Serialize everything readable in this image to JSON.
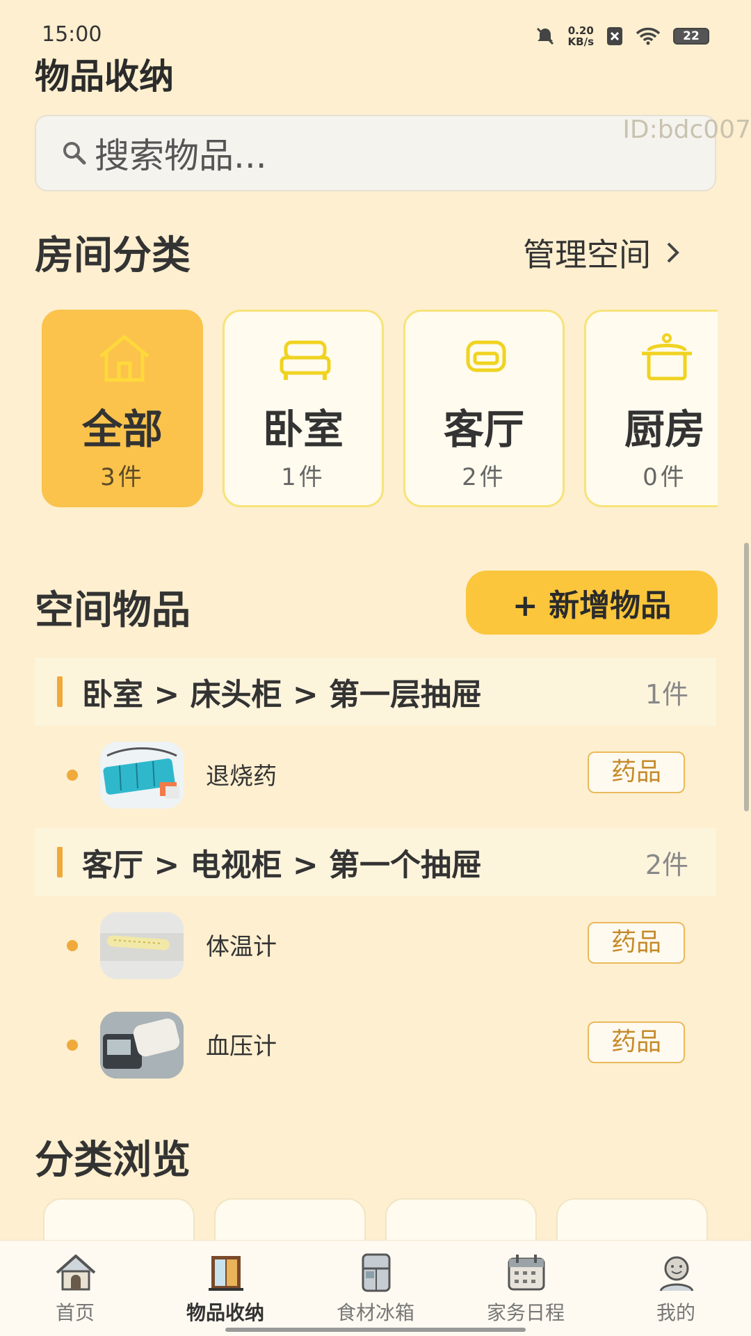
{
  "status_bar": {
    "time": "15:00",
    "net_speed_value": "0.20",
    "net_speed_unit": "KB/s",
    "battery": "22"
  },
  "page_title": "物品收纳",
  "search": {
    "placeholder": "搜索物品...",
    "watermark": "ID:bdc007"
  },
  "rooms_section": {
    "title": "房间分类",
    "manage_link": "管理空间"
  },
  "rooms": [
    {
      "name": "全部",
      "count": "3件",
      "icon": "house-icon",
      "active": true
    },
    {
      "name": "卧室",
      "count": "1件",
      "icon": "bed-icon",
      "active": false
    },
    {
      "name": "客厅",
      "count": "2件",
      "icon": "sofa-icon",
      "active": false
    },
    {
      "name": "厨房",
      "count": "0件",
      "icon": "pot-icon",
      "active": false
    }
  ],
  "items_section": {
    "title": "空间物品",
    "add_button": "+ 新增物品"
  },
  "groups": [
    {
      "path": "卧室 > 床头柜 > 第一层抽屉",
      "count": "1件",
      "items": [
        {
          "name": "退烧药",
          "tag": "药品",
          "thumb": "pill-box"
        }
      ]
    },
    {
      "path": "客厅 > 电视柜 > 第一个抽屉",
      "count": "2件",
      "items": [
        {
          "name": "体温计",
          "tag": "药品",
          "thumb": "thermometer"
        },
        {
          "name": "血压计",
          "tag": "药品",
          "thumb": "blood-pressure-monitor"
        }
      ]
    }
  ],
  "browse_section": {
    "title": "分类浏览"
  },
  "bottom_nav": [
    {
      "label": "首页",
      "icon": "home-icon",
      "active": false
    },
    {
      "label": "物品收纳",
      "icon": "cabinet-icon",
      "active": true
    },
    {
      "label": "食材冰箱",
      "icon": "fridge-icon",
      "active": false
    },
    {
      "label": "家务日程",
      "icon": "calendar-icon",
      "active": false
    },
    {
      "label": "我的",
      "icon": "profile-icon",
      "active": false
    }
  ],
  "colors": {
    "background": "#fdefcf",
    "accent": "#fbc34c",
    "tag_border": "#e9b95b",
    "dot": "#f0a93b"
  }
}
